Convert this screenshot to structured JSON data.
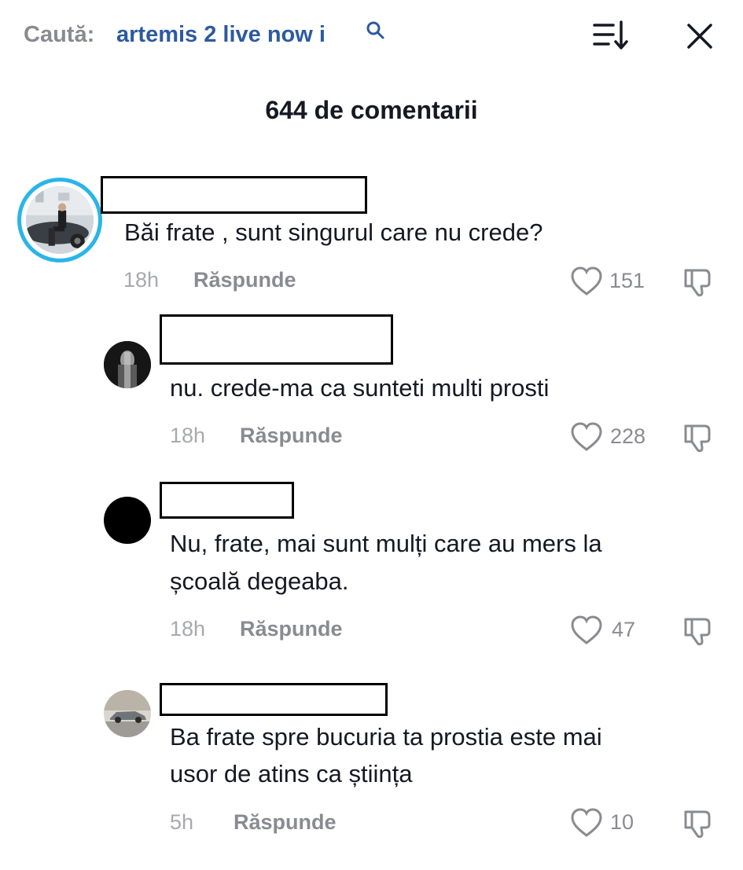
{
  "header": {
    "search_prefix": "Caută:",
    "search_query": "artemis 2 live now i",
    "search_icon": "search-icon",
    "sort_icon": "sort-icon",
    "close_icon": "close-icon"
  },
  "comments_title": "644 de comentarii",
  "colors": {
    "query_blue": "#2c5aa0",
    "story_ring": "#2ab5e8",
    "muted": "#8a8b91"
  },
  "comments": [
    {
      "text_lines": [
        "Băi frate , sunt singurul care nu crede?"
      ],
      "time": "18h",
      "reply_label": "Răspunde",
      "likes": "151"
    },
    {
      "text_lines": [
        "nu. crede-ma ca sunteti multi prosti"
      ],
      "time": "18h",
      "reply_label": "Răspunde",
      "likes": "228"
    },
    {
      "text_lines": [
        "Nu, frate, mai sunt mulți care au mers la",
        "școală degeaba."
      ],
      "time": "18h",
      "reply_label": "Răspunde",
      "likes": "47"
    },
    {
      "text_lines": [
        "Ba frate spre bucuria ta prostia este mai",
        "usor de atins ca știința"
      ],
      "time": "5h",
      "reply_label": "Răspunde",
      "likes": "10"
    }
  ]
}
